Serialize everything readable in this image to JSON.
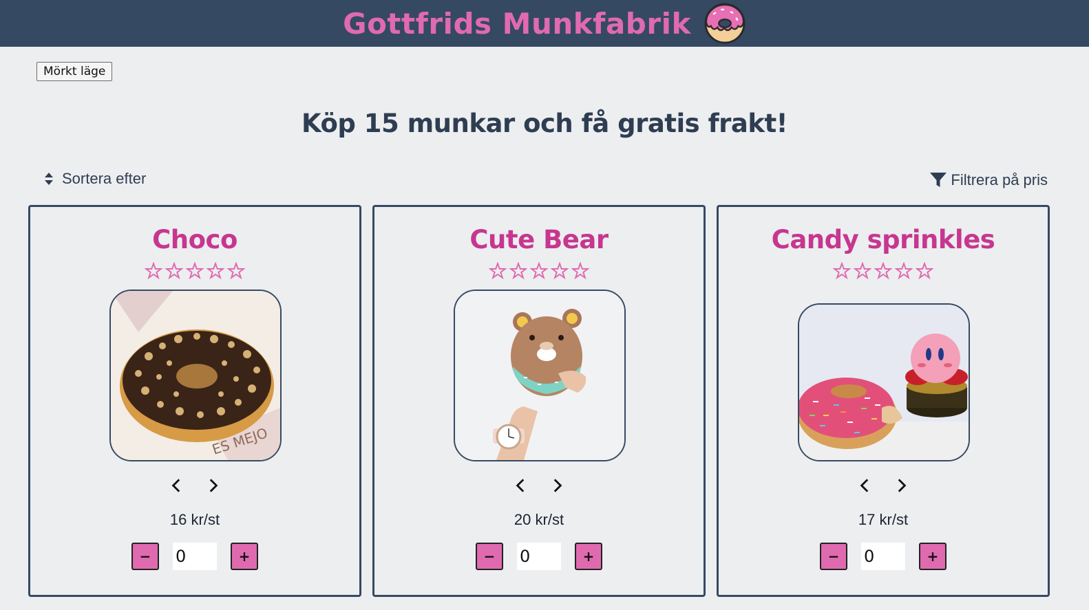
{
  "header": {
    "brand": "Gottfrids Munkfabrik",
    "logo_icon": "donut-logo-icon"
  },
  "controls": {
    "dark_mode_label": "Mörkt läge",
    "sort_label": "Sortera efter",
    "sort_icon": "sort-icon",
    "filter_label": "Filtrera på pris",
    "filter_icon": "funnel-icon"
  },
  "promo": "Köp 15 munkar och få gratis frakt!",
  "colors": {
    "header_bg": "#364962",
    "brand_pink": "#e06ab0",
    "title_magenta": "#c7368f",
    "page_bg": "#eceef0"
  },
  "products": [
    {
      "name": "Choco",
      "rating": 0,
      "max_rating": 5,
      "price": "16 kr/st",
      "quantity": "0",
      "image": "chocolate donut with nuts"
    },
    {
      "name": "Cute Bear",
      "rating": 0,
      "max_rating": 5,
      "price": "20 kr/st",
      "quantity": "0",
      "image": "bear shaped donut in hand"
    },
    {
      "name": "Candy sprinkles",
      "rating": 0,
      "max_rating": 5,
      "price": "17 kr/st",
      "quantity": "0",
      "image": "pink sprinkle donut with figure"
    }
  ]
}
